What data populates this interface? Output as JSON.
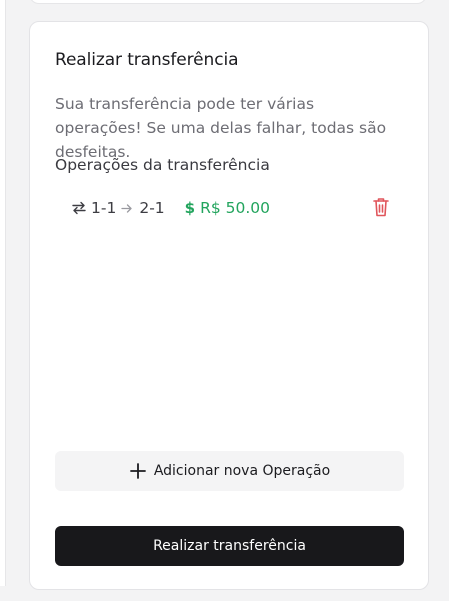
{
  "card": {
    "title": "Realizar transferência",
    "description": "Sua transferência pode ter várias operações! Se uma delas falhar, todas são desfeitas.",
    "operations_title": "Operações da transferência"
  },
  "operations": [
    {
      "from": "1-1",
      "to": "2-1",
      "amount": "R$ 50.00"
    }
  ],
  "buttons": {
    "add_operation": "Adicionar nova Operação",
    "submit": "Realizar transferência"
  },
  "icons": {
    "swap": "swap-horizontal-icon",
    "arrow": "arrow-right-icon",
    "dollar": "dollar-sign-icon",
    "trash": "trash-icon",
    "plus": "plus-icon"
  },
  "colors": {
    "amount": "#22a45d",
    "delete": "#e0555b",
    "primary_button": "#18181b",
    "secondary_button": "#f4f4f5"
  }
}
